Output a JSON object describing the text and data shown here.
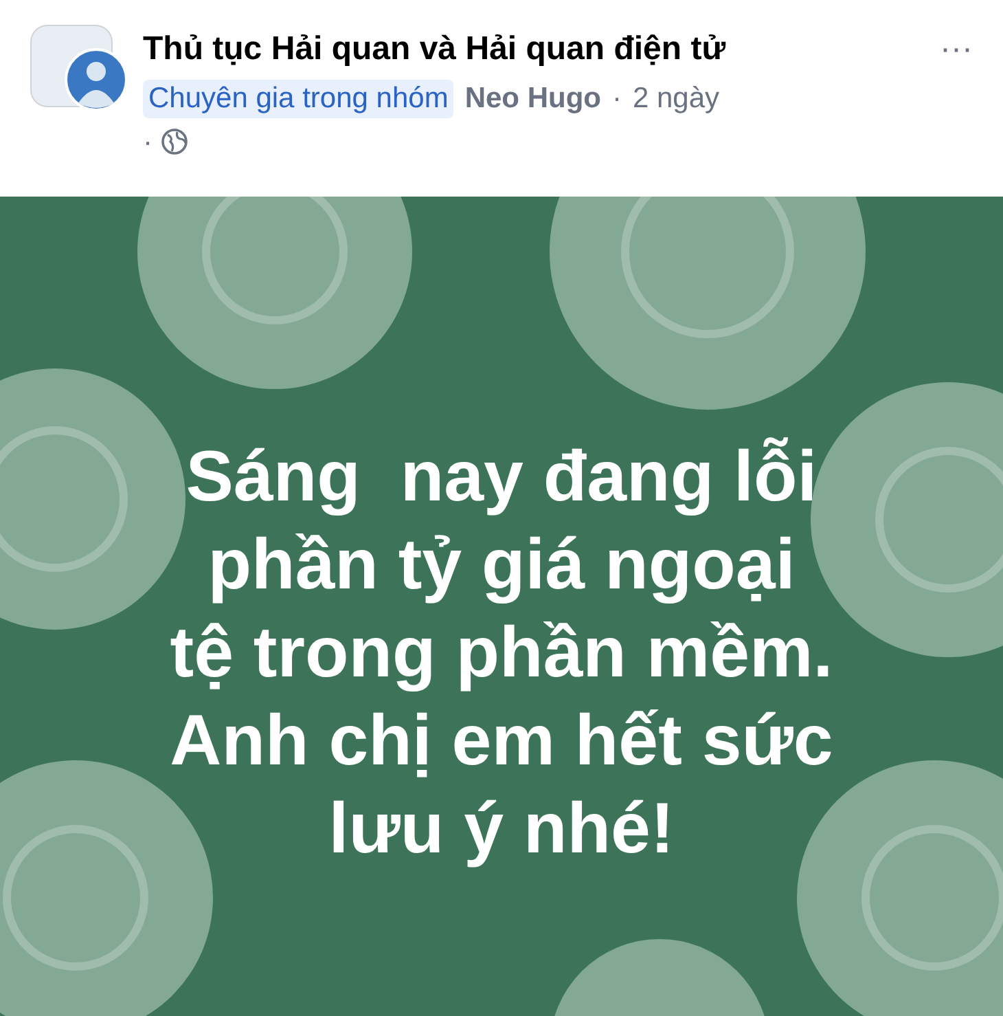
{
  "post_header": {
    "group_name": "Thủ tục Hải quan và Hải quan điện tử",
    "more": "···",
    "badge": "Chuyên gia trong nhóm",
    "author": "Neo Hugo",
    "separator": "·",
    "time": "2 ngày",
    "privacy_separator": "·"
  },
  "post_body": {
    "text_lines": [
      "Sáng  nay đang lỗi",
      "phần tỷ giá ngoại",
      "tệ trong phần mềm.",
      "Anh chị em hết sức",
      "lưu ý nhé!"
    ]
  }
}
